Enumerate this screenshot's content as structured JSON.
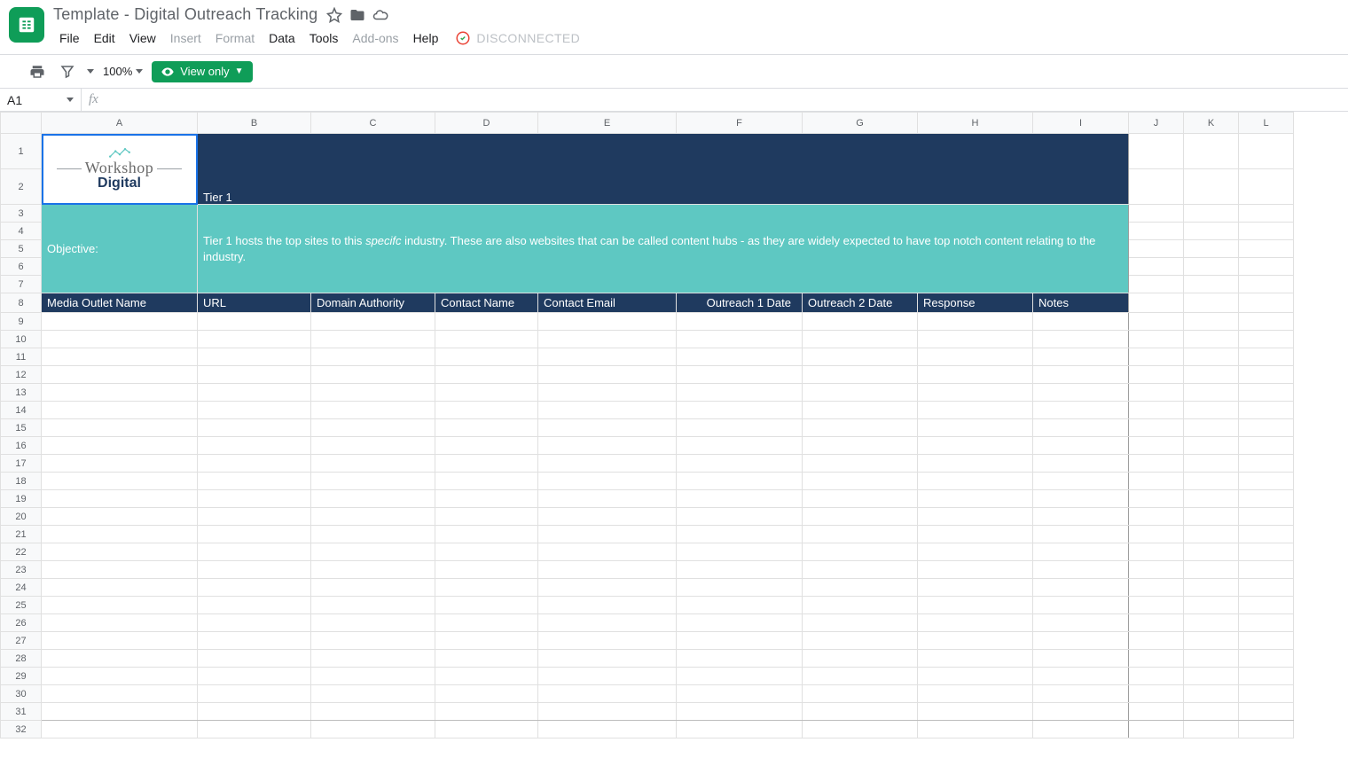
{
  "doc": {
    "title": "Template - Digital Outreach Tracking"
  },
  "menu": {
    "file": "File",
    "edit": "Edit",
    "view": "View",
    "insert": "Insert",
    "format": "Format",
    "data": "Data",
    "tools": "Tools",
    "addons": "Add-ons",
    "help": "Help",
    "disconnected": "DISCONNECTED"
  },
  "toolbar": {
    "zoom": "100%",
    "view_only": "View only"
  },
  "formula": {
    "name_box": "A1",
    "value": ""
  },
  "columns": [
    "A",
    "B",
    "C",
    "D",
    "E",
    "F",
    "G",
    "H",
    "I",
    "J",
    "K",
    "L"
  ],
  "rows_visible": 32,
  "logo": {
    "line1": "Workshop",
    "line2": "Digital"
  },
  "tier": {
    "title": "Tier 1"
  },
  "objective": {
    "label": "Objective:",
    "text_plain": "Tier 1 hosts the top sites to this specifc industry. These are also websites that can be called content hubs - as they are widely expected to have top notch content relating to the industry.",
    "text_html": "Tier 1 hosts the top sites to this <em>specifc</em> industry. These are also websites that can be called content hubs - as they are widely expected to have top notch content relating to the industry."
  },
  "headers": {
    "media_outlet": "Media Outlet Name",
    "url": "URL",
    "domain_authority": "Domain Authority",
    "contact_name": "Contact Name",
    "contact_email": "Contact Email",
    "outreach1": "Outreach 1 Date",
    "outreach2": "Outreach 2 Date",
    "response": "Response",
    "notes": "Notes"
  },
  "colors": {
    "navy": "#1f3a5f",
    "teal": "#5ec8c2",
    "accent_green": "#0f9d58"
  }
}
